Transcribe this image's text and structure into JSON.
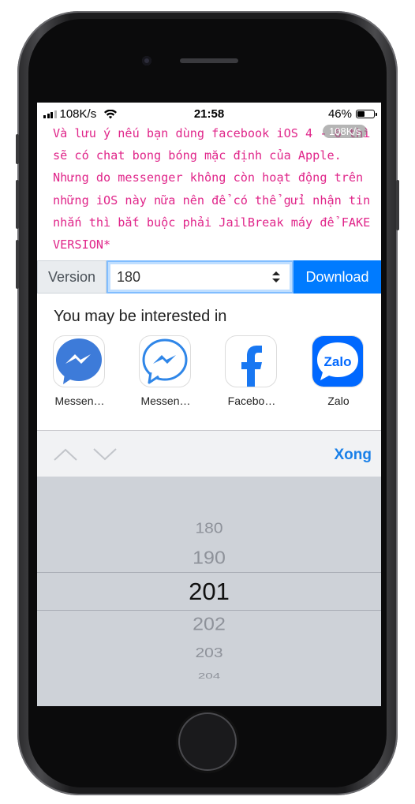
{
  "status_bar": {
    "network_speed": "108K/s",
    "time": "21:58",
    "battery": "46%"
  },
  "article": {
    "text": "Và lưu ý nếu bạn dùng facebook iOS 4 - 6 thì sẽ có chat bong bóng mặc định của Apple. Nhưng do messenger không còn hoạt động trên những iOS này nữa nên để có thể gửi nhận tin nhắn thì bắt buộc phải JailBreak máy để FAKE VERSION*",
    "speed_badge": "108K/s",
    "text_color": "#e0268a"
  },
  "version_form": {
    "label": "Version",
    "selected": "180",
    "download_label": "Download",
    "accent": "#007bff"
  },
  "interest": {
    "title": "You may be interested in",
    "apps": [
      {
        "label": "Messen…",
        "icon": "messenger-icon-filled"
      },
      {
        "label": "Messen…",
        "icon": "messenger-icon-outline"
      },
      {
        "label": "Facebo…",
        "icon": "facebook-icon"
      },
      {
        "label": "Zalo",
        "icon": "zalo-icon",
        "icon_text": "Zalo"
      }
    ]
  },
  "toolbar": {
    "prev_icon": "chevron-up-icon",
    "next_icon": "chevron-down-icon",
    "done_label": "Xong"
  },
  "picker": {
    "options": [
      "180",
      "190",
      "201",
      "202",
      "203",
      "204"
    ],
    "selected": "201"
  }
}
